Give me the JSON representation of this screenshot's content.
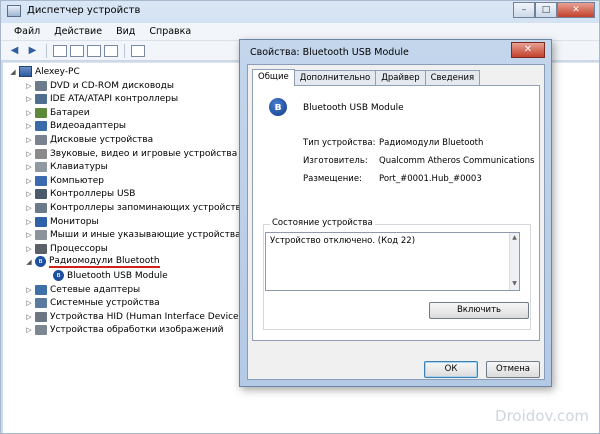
{
  "window": {
    "title": "Диспетчер устройств",
    "minimize": "–",
    "maximize": "□",
    "close": "✕"
  },
  "menu": [
    "Файл",
    "Действие",
    "Вид",
    "Справка"
  ],
  "toolbar": {
    "back": "◀",
    "forward": "▶"
  },
  "tree": {
    "root": "Alexey-PC",
    "items": [
      {
        "label": "DVD и CD-ROM дисководы",
        "color": "#6b7b8c"
      },
      {
        "label": "IDE ATA/ATAPI контроллеры",
        "color": "#4f6f8f"
      },
      {
        "label": "Батареи",
        "color": "#5d8a3a"
      },
      {
        "label": "Видеоадаптеры",
        "color": "#3a6aa8"
      },
      {
        "label": "Дисковые устройства",
        "color": "#7a8290"
      },
      {
        "label": "Звуковые, видео и игровые устройства",
        "color": "#8a8a8a"
      },
      {
        "label": "Клавиатуры",
        "color": "#9098a2"
      },
      {
        "label": "Компьютер",
        "color": "#3a6ab0"
      },
      {
        "label": "Контроллеры USB",
        "color": "#4a5a6a"
      },
      {
        "label": "Контроллеры запоминающих устройств",
        "color": "#6a7a8a"
      },
      {
        "label": "Мониторы",
        "color": "#2f62a6"
      },
      {
        "label": "Мыши и иные указывающие устройства",
        "color": "#8c939b"
      },
      {
        "label": "Процессоры",
        "color": "#5a6068"
      }
    ],
    "bluetooth_group": "Радиомодули Bluetooth",
    "bluetooth_child": "Bluetooth USB Module",
    "items_after": [
      {
        "label": "Сетевые адаптеры",
        "color": "#3f6fa8"
      },
      {
        "label": "Системные устройства",
        "color": "#5a7aa0"
      },
      {
        "label": "Устройства HID (Human Interface Devices)",
        "color": "#6c7682"
      },
      {
        "label": "Устройства обработки изображений",
        "color": "#7d8792"
      }
    ]
  },
  "watermark": "Droidov.com",
  "dialog": {
    "title": "Свойства: Bluetooth USB Module",
    "close": "✕",
    "tabs": [
      "Общие",
      "Дополнительно",
      "Драйвер",
      "Сведения"
    ],
    "device_name": "Bluetooth USB Module",
    "props": [
      {
        "key": "Тип устройства:",
        "value": "Радиомодули Bluetooth"
      },
      {
        "key": "Изготовитель:",
        "value": "Qualcomm Atheros Communications"
      },
      {
        "key": "Размещение:",
        "value": "Port_#0001.Hub_#0003"
      }
    ],
    "status_group": "Состояние устройства",
    "status_text": "Устройство отключено. (Код 22)",
    "enable_button": "Включить",
    "ok_button": "ОК",
    "cancel_button": "Отмена"
  }
}
